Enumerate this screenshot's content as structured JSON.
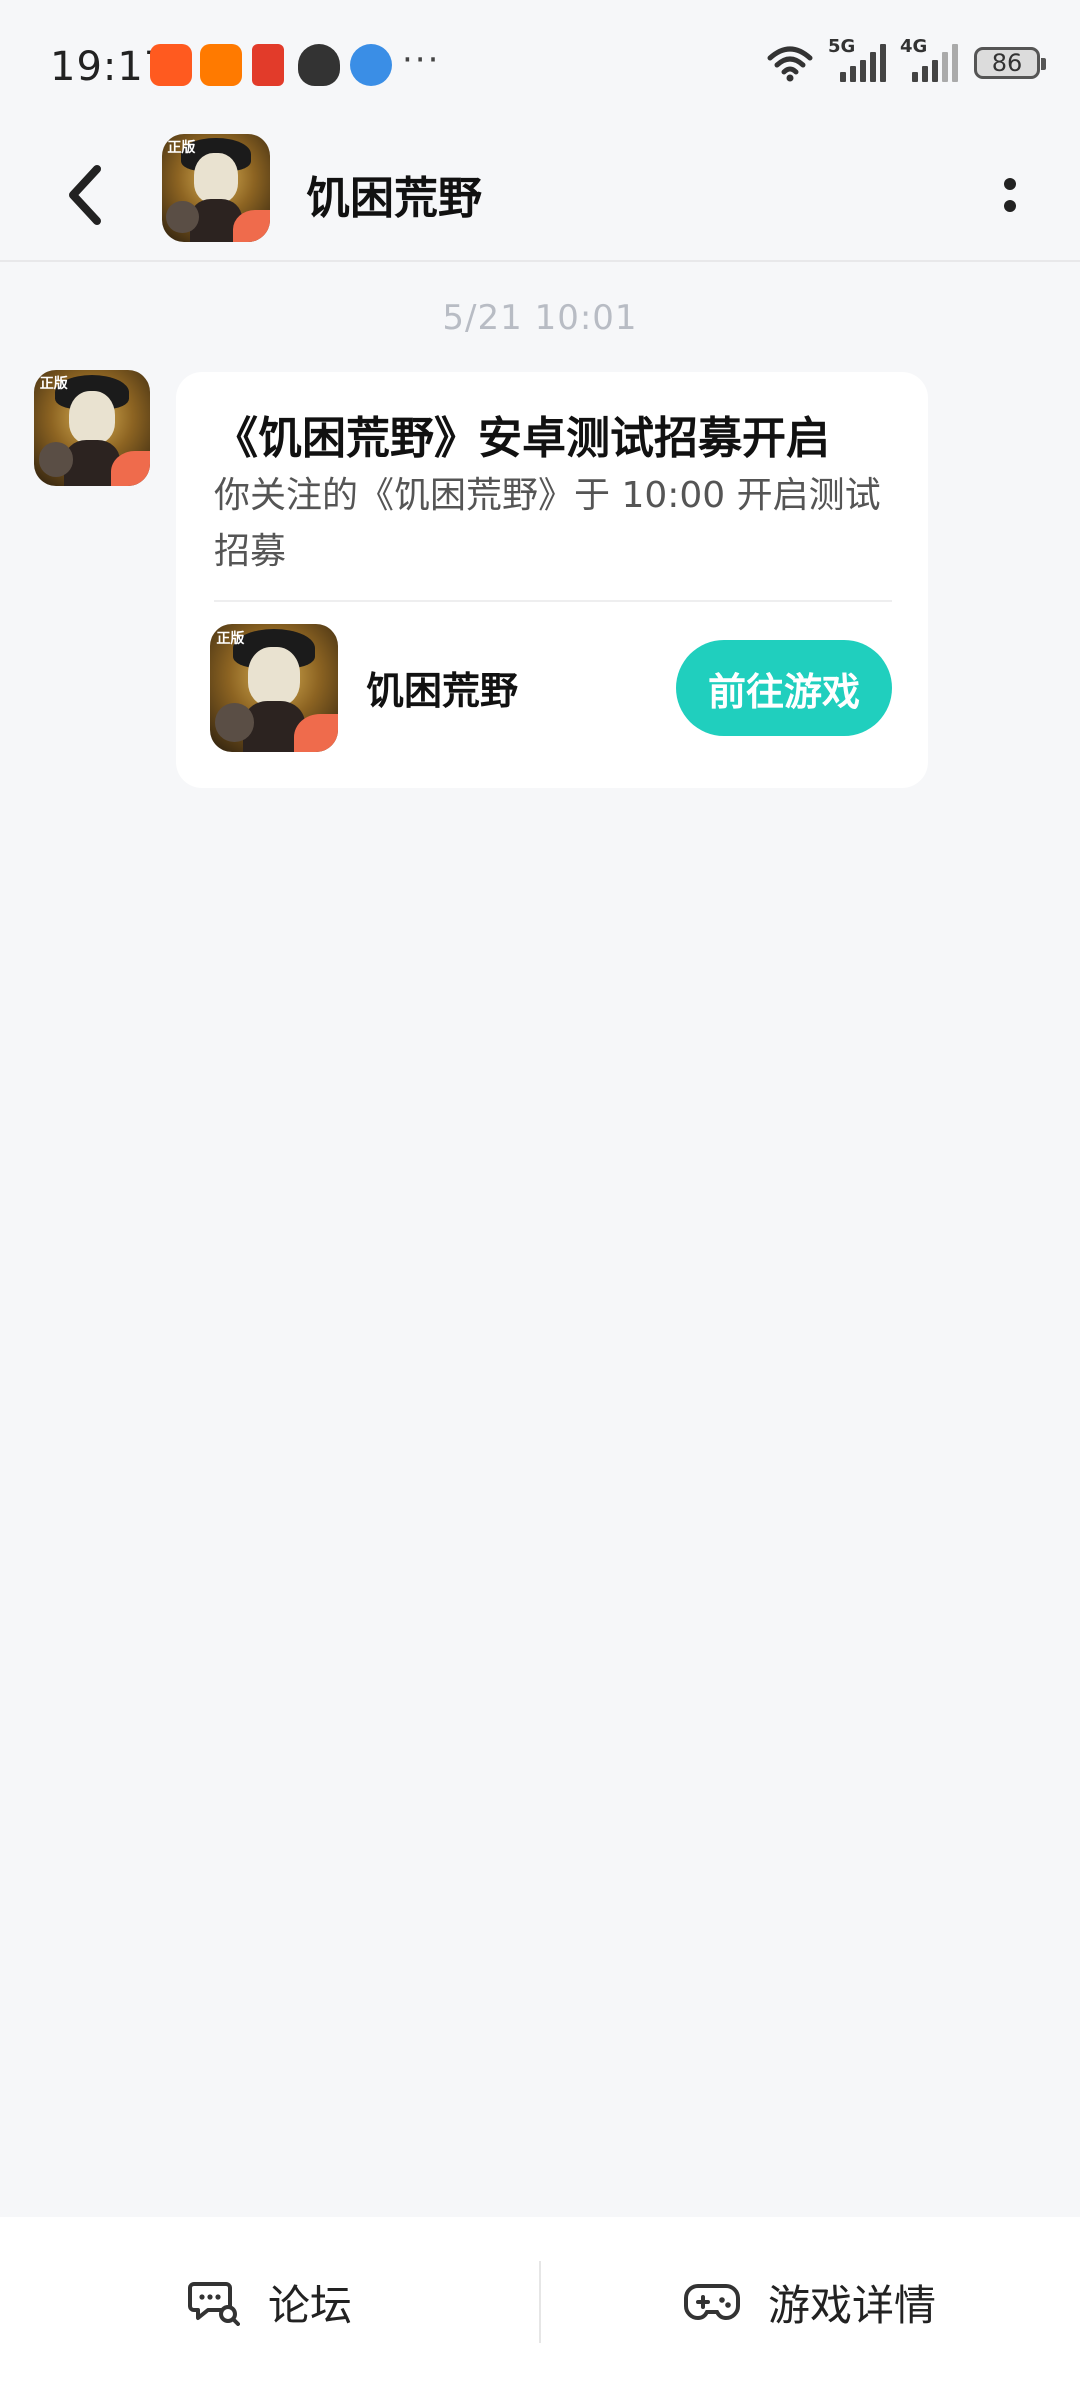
{
  "status_bar": {
    "time": "19:17",
    "network_1": "5G",
    "network_2": "4G",
    "battery": "86",
    "notification_icons": [
      {
        "name": "taobao-app-icon",
        "color": "#ff5a1f"
      },
      {
        "name": "shop-app-icon",
        "color": "#ff7a00"
      },
      {
        "name": "red-packet-icon",
        "color": "#e23b2a"
      },
      {
        "name": "qq-penguin-icon",
        "color": "#333333"
      },
      {
        "name": "browser-planet-icon",
        "color": "#3a8ee6"
      }
    ],
    "more_dots": "···"
  },
  "header": {
    "title": "饥困荒野"
  },
  "message": {
    "timestamp": "5/21 10:01",
    "title": "《饥困荒野》安卓测试招募开启",
    "body": "你关注的《饥困荒野》于 10:00 开启测试招募",
    "game_name": "饥困荒野",
    "button_label": "前往游戏"
  },
  "bottom_bar": {
    "forum_label": "论坛",
    "details_label": "游戏详情"
  },
  "icon_tag": "正版",
  "colors": {
    "accent": "#20cfbe",
    "background": "#f6f7f9",
    "card": "#ffffff"
  }
}
